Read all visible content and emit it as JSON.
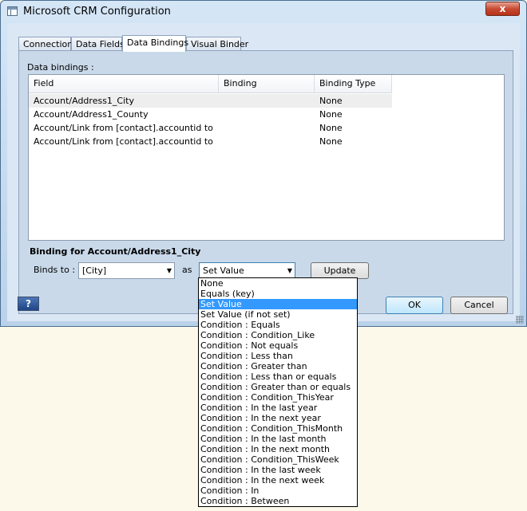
{
  "window": {
    "title": "Microsoft CRM Configuration",
    "close_label": "x"
  },
  "tabs": [
    {
      "label": "Connection"
    },
    {
      "label": "Data Fields"
    },
    {
      "label": "Data Bindings"
    },
    {
      "label": "Visual Binder"
    }
  ],
  "active_tab": "Data Bindings",
  "bindings": {
    "section_label": "Data bindings :",
    "columns": [
      "Field",
      "Binding",
      "Binding Type"
    ],
    "rows": [
      {
        "field": "Account/Address1_City",
        "binding": "",
        "binding_type": "None"
      },
      {
        "field": "Account/Address1_County",
        "binding": "",
        "binding_type": "None"
      },
      {
        "field": "Account/Link from [contact].accountid to acc...",
        "binding": "",
        "binding_type": "None"
      },
      {
        "field": "Account/Link from [contact].accountid to acc...",
        "binding": "",
        "binding_type": "None"
      }
    ]
  },
  "binding_detail": {
    "title": "Binding for Account/Address1_City",
    "binds_to_label": "Binds to :",
    "binds_to_value": "[City]",
    "as_label": "as",
    "type_value": "Set Value",
    "update_label": "Update"
  },
  "footer": {
    "help_label": "?",
    "ok_label": "OK",
    "cancel_label": "Cancel"
  },
  "dropdown": {
    "selected": "Set Value",
    "options": [
      "None",
      "Equals (key)",
      "Set Value",
      "Set Value (if not set)",
      "Condition : Equals",
      "Condition : Condition_Like",
      "Condition : Not equals",
      "Condition : Less than",
      "Condition : Greater than",
      "Condition : Less than or equals",
      "Condition : Greater than or equals",
      "Condition : Condition_ThisYear",
      "Condition : In the last year",
      "Condition : In the next year",
      "Condition : Condition_ThisMonth",
      "Condition : In the last month",
      "Condition : In the next month",
      "Condition : Condition_ThisWeek",
      "Condition : In the last week",
      "Condition : In the next week",
      "Condition : In",
      "Condition : Between"
    ]
  }
}
